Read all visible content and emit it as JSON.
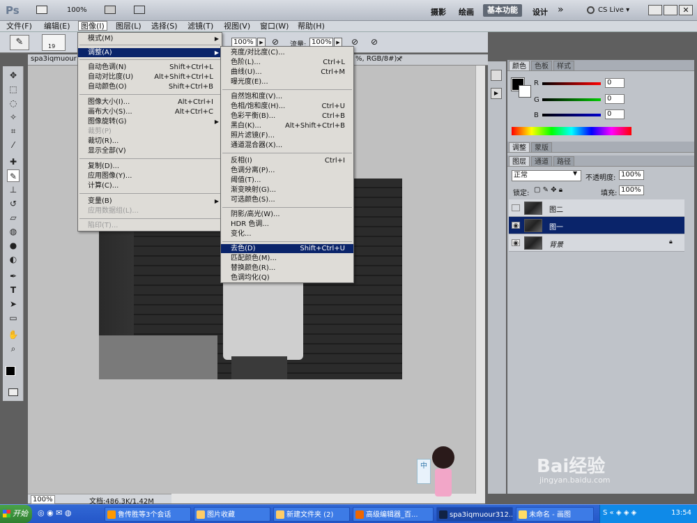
{
  "appbar": {
    "logo": "Ps",
    "zoom": "100%",
    "workspaces": [
      "摄影",
      "绘画",
      "基本功能",
      "设计"
    ],
    "more": "»",
    "cslive": "CS Live ▾"
  },
  "menubar": [
    "文件(F)",
    "编辑(E)",
    "图像(I)",
    "图层(L)",
    "选择(S)",
    "滤镜(T)",
    "视图(V)",
    "窗口(W)",
    "帮助(H)"
  ],
  "options": {
    "brush_size": "19",
    "opacity_label": "",
    "opacity_value": "100%",
    "flow_label": "流量:",
    "flow_value": "100%"
  },
  "doc_tab": {
    "title": "spa3iqmuour",
    "suffix": "%, RGB/8#) *",
    "close": "×"
  },
  "image_menu": [
    {
      "label": "模式(M)",
      "shortcut": "",
      "arrow": true
    },
    {
      "label": "调整(A)",
      "shortcut": "",
      "arrow": true,
      "highlight": true
    },
    {
      "label": "自动色调(N)",
      "shortcut": "Shift+Ctrl+L"
    },
    {
      "label": "自动对比度(U)",
      "shortcut": "Alt+Shift+Ctrl+L"
    },
    {
      "label": "自动颜色(O)",
      "shortcut": "Shift+Ctrl+B"
    },
    {
      "label": "图像大小(I)...",
      "shortcut": "Alt+Ctrl+I"
    },
    {
      "label": "画布大小(S)...",
      "shortcut": "Alt+Ctrl+C"
    },
    {
      "label": "图像旋转(G)",
      "shortcut": "",
      "arrow": true
    },
    {
      "label": "裁剪(P)",
      "shortcut": "",
      "disabled": true
    },
    {
      "label": "裁切(R)...",
      "shortcut": ""
    },
    {
      "label": "显示全部(V)",
      "shortcut": ""
    },
    {
      "label": "复制(D)...",
      "shortcut": ""
    },
    {
      "label": "应用图像(Y)...",
      "shortcut": ""
    },
    {
      "label": "计算(C)...",
      "shortcut": ""
    },
    {
      "label": "变量(B)",
      "shortcut": "",
      "arrow": true
    },
    {
      "label": "应用数据组(L)...",
      "shortcut": "",
      "disabled": true
    },
    {
      "label": "陷印(T)...",
      "shortcut": "",
      "disabled": true
    }
  ],
  "adjust_menu": [
    {
      "label": "亮度/对比度(C)...",
      "shortcut": ""
    },
    {
      "label": "色阶(L)...",
      "shortcut": "Ctrl+L"
    },
    {
      "label": "曲线(U)...",
      "shortcut": "Ctrl+M"
    },
    {
      "label": "曝光度(E)...",
      "shortcut": ""
    },
    {
      "label": "自然饱和度(V)...",
      "shortcut": ""
    },
    {
      "label": "色相/饱和度(H)...",
      "shortcut": "Ctrl+U"
    },
    {
      "label": "色彩平衡(B)...",
      "shortcut": "Ctrl+B"
    },
    {
      "label": "黑白(K)...",
      "shortcut": "Alt+Shift+Ctrl+B"
    },
    {
      "label": "照片滤镜(F)...",
      "shortcut": ""
    },
    {
      "label": "通道混合器(X)...",
      "shortcut": ""
    },
    {
      "label": "反相(I)",
      "shortcut": "Ctrl+I"
    },
    {
      "label": "色调分离(P)...",
      "shortcut": ""
    },
    {
      "label": "阈值(T)...",
      "shortcut": ""
    },
    {
      "label": "渐变映射(G)...",
      "shortcut": ""
    },
    {
      "label": "可选颜色(S)...",
      "shortcut": ""
    },
    {
      "label": "阴影/高光(W)...",
      "shortcut": ""
    },
    {
      "label": "HDR 色调...",
      "shortcut": ""
    },
    {
      "label": "变化...",
      "shortcut": ""
    },
    {
      "label": "去色(D)",
      "shortcut": "Shift+Ctrl+U",
      "highlight": true
    },
    {
      "label": "匹配颜色(M)...",
      "shortcut": ""
    },
    {
      "label": "替换颜色(R)...",
      "shortcut": ""
    },
    {
      "label": "色调均化(Q)",
      "shortcut": ""
    }
  ],
  "color_panel": {
    "tabs": [
      "颜色",
      "色板",
      "样式"
    ],
    "r_label": "R",
    "g_label": "G",
    "b_label": "B",
    "r": "0",
    "g": "0",
    "b": "0"
  },
  "adjust_panel": {
    "tabs": [
      "调整",
      "蒙版"
    ]
  },
  "layers_panel": {
    "tabs": [
      "图层",
      "通道",
      "路径"
    ],
    "blend_mode": "正常",
    "opacity_label": "不透明度:",
    "opacity": "100%",
    "lock_label": "锁定:",
    "fill_label": "填充:",
    "fill": "100%",
    "layers": [
      {
        "name": "图二",
        "visible": false,
        "selected": false
      },
      {
        "name": "图一",
        "visible": true,
        "selected": true
      },
      {
        "name": "背景",
        "visible": true,
        "selected": false,
        "locked": true
      }
    ]
  },
  "status": {
    "zoom": "100%",
    "doc": "文档:486.3K/1.42M"
  },
  "taskbar": {
    "start": "开始",
    "items": [
      "鲁传胜等3个会话",
      "图片收藏",
      "新建文件夹 (2)",
      "高级编辑器_百...",
      "spa3iqmuour312...",
      "未命名 - 画图"
    ],
    "clock": "13:54"
  },
  "watermark": {
    "brand": "Bai经验",
    "url": "jingyan.baidu.com"
  },
  "colors": {
    "menu_highlight": "#0a246a",
    "taskbar": "#2456c8"
  }
}
